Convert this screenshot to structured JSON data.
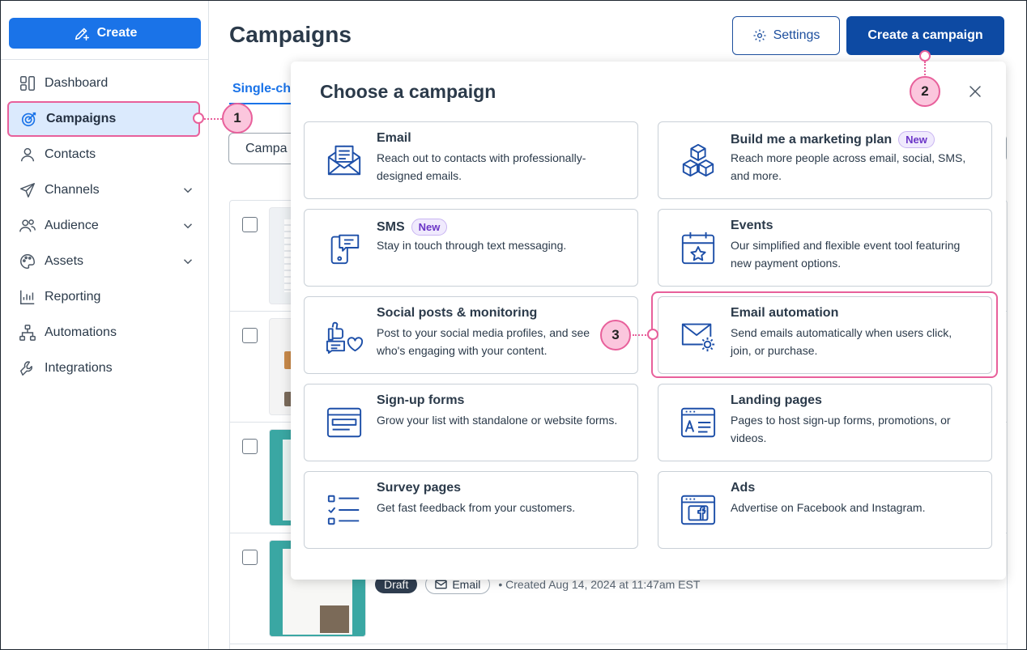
{
  "sidebar": {
    "create_label": "Create",
    "items": [
      {
        "label": "Dashboard",
        "icon": "dashboard-icon"
      },
      {
        "label": "Campaigns",
        "icon": "target-icon"
      },
      {
        "label": "Contacts",
        "icon": "user-icon"
      },
      {
        "label": "Channels",
        "icon": "send-icon"
      },
      {
        "label": "Audience",
        "icon": "users-icon"
      },
      {
        "label": "Assets",
        "icon": "palette-icon"
      },
      {
        "label": "Reporting",
        "icon": "chart-icon"
      },
      {
        "label": "Automations",
        "icon": "flow-icon"
      },
      {
        "label": "Integrations",
        "icon": "wrench-icon"
      }
    ]
  },
  "header": {
    "title": "Campaigns",
    "settings_label": "Settings",
    "create_campaign_label": "Create a campaign"
  },
  "tabs": {
    "partial_label": "Single-ch"
  },
  "filter": {
    "partial_label": "Campa"
  },
  "rows": [
    {
      "status": "Draft",
      "type": "Email",
      "created": "• Created Aug 14, 2024 at 11:47am EST"
    }
  ],
  "modal": {
    "title": "Choose a campaign",
    "cards": [
      {
        "title": "Email",
        "desc": "Reach out to contacts with professionally-designed emails.",
        "icon": "envelope-icon"
      },
      {
        "title": "Build me a marketing plan",
        "badge": "New",
        "desc": "Reach more people across email, social, SMS, and more.",
        "icon": "cubes-icon"
      },
      {
        "title": "SMS",
        "badge": "New",
        "desc": "Stay in touch through text messaging.",
        "icon": "phone-message-icon"
      },
      {
        "title": "Events",
        "desc": "Our simplified and flexible event tool featuring new payment options.",
        "icon": "calendar-star-icon"
      },
      {
        "title": "Social posts & monitoring",
        "desc": "Post to your social media profiles, and see who's engaging with your content.",
        "icon": "social-icon"
      },
      {
        "title": "Email automation",
        "desc": "Send emails automatically when users click, join, or purchase.",
        "icon": "envelope-gear-icon"
      },
      {
        "title": "Sign-up forms",
        "desc": "Grow your list with standalone or website forms.",
        "icon": "form-icon"
      },
      {
        "title": "Landing pages",
        "desc": "Pages to host sign-up forms, promotions, or videos.",
        "icon": "landing-page-icon"
      },
      {
        "title": "Survey pages",
        "desc": "Get fast feedback from your customers.",
        "icon": "checklist-icon"
      },
      {
        "title": "Ads",
        "desc": "Advertise on Facebook and Instagram.",
        "icon": "facebook-ad-icon"
      }
    ]
  },
  "callouts": [
    "1",
    "2",
    "3"
  ],
  "colors": {
    "primary": "#1a73e8",
    "cta": "#0d4aa3",
    "highlight": "#e8609b",
    "icon": "#1d4fa8"
  }
}
